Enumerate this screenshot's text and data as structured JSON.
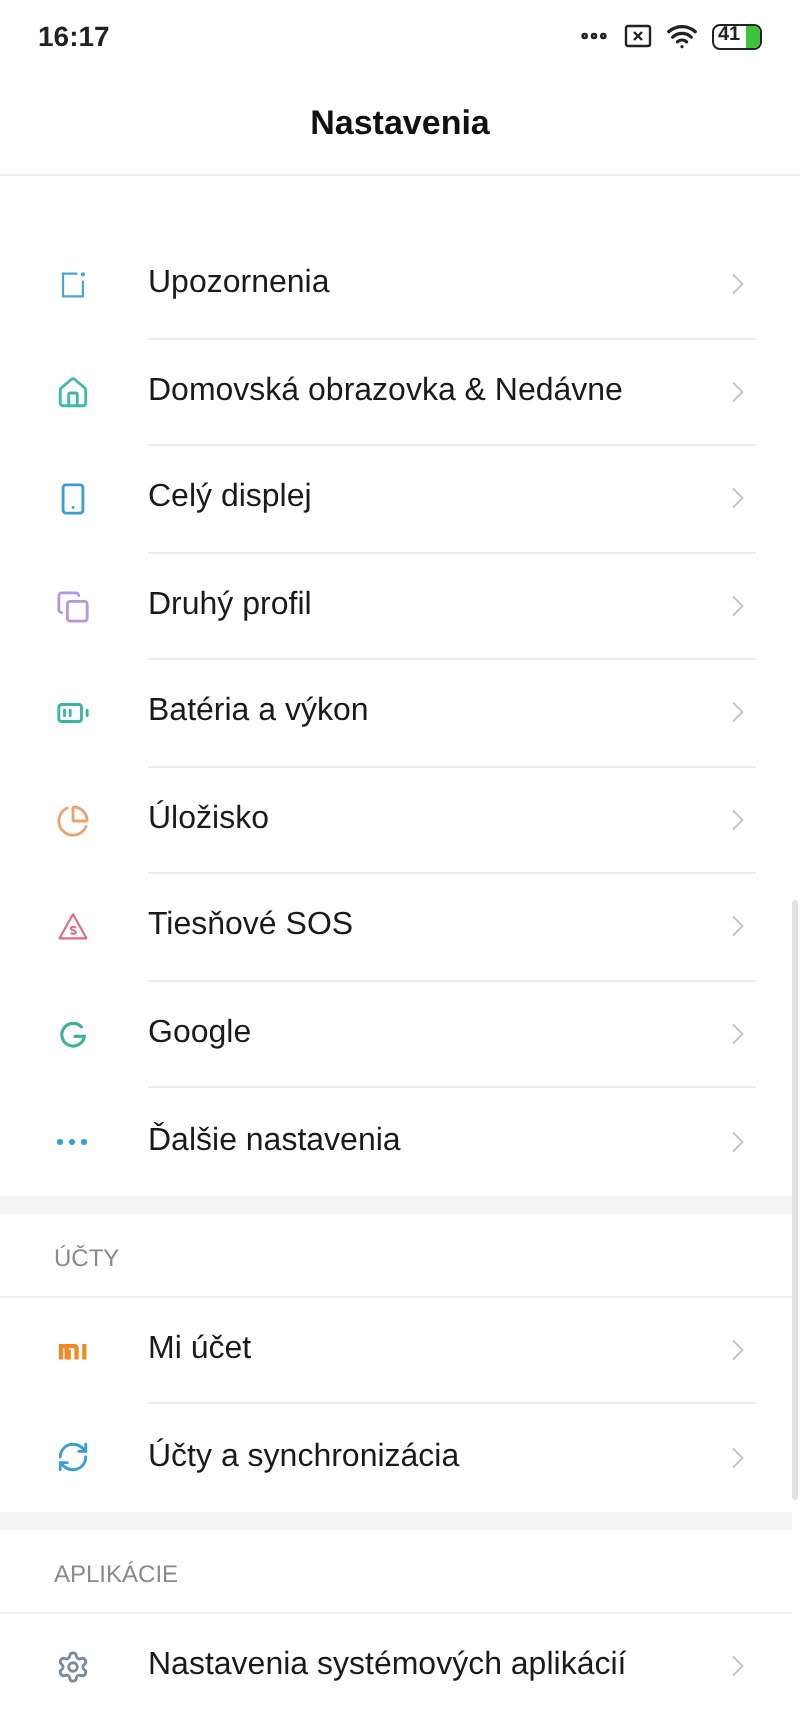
{
  "status_bar": {
    "time": "16:17",
    "battery": "41"
  },
  "header": {
    "title": "Nastavenia"
  },
  "sections": [
    {
      "items": [
        {
          "label": "Upozornenia"
        },
        {
          "label": "Domovská obrazovka & Nedávne"
        },
        {
          "label": "Celý displej"
        },
        {
          "label": "Druhý profil"
        },
        {
          "label": "Batéria a výkon"
        },
        {
          "label": "Úložisko"
        },
        {
          "label": "Tiesňové SOS"
        },
        {
          "label": "Google"
        },
        {
          "label": "Ďalšie nastavenia"
        }
      ]
    },
    {
      "title": "ÚČTY",
      "items": [
        {
          "label": "Mi účet"
        },
        {
          "label": "Účty a synchronizácia"
        }
      ]
    },
    {
      "title": "APLIKÁCIE",
      "items": [
        {
          "label": "Nastavenia systémových aplikácií"
        }
      ]
    }
  ]
}
